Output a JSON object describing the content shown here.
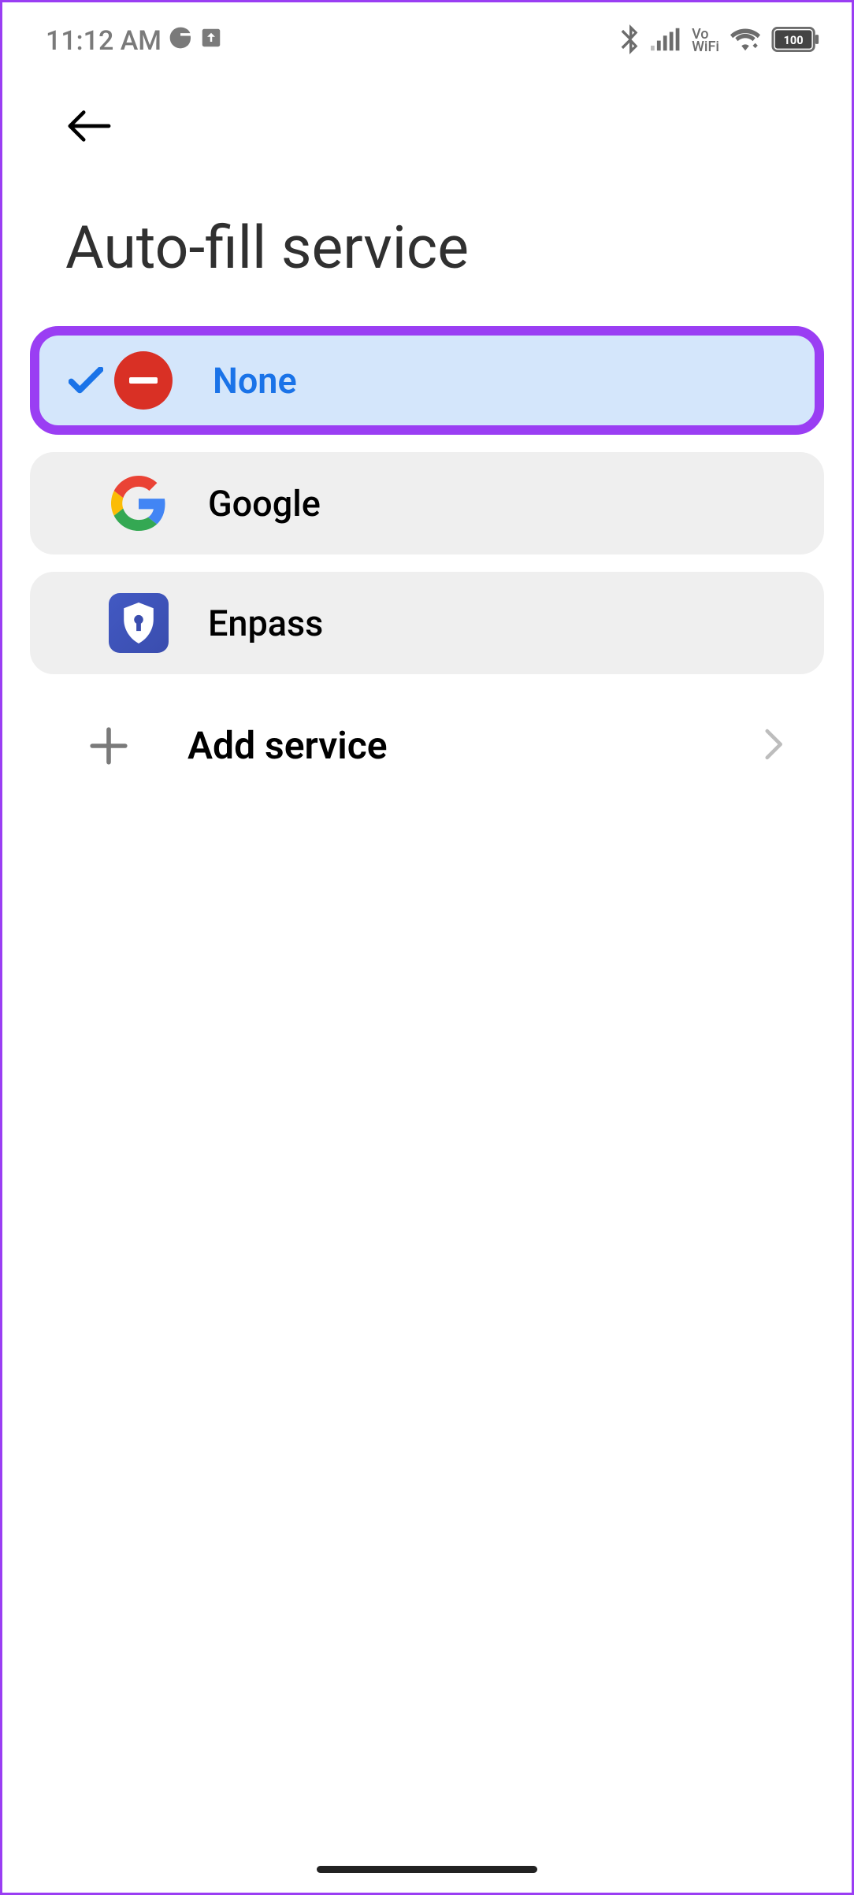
{
  "status_bar": {
    "time": "11:12 AM",
    "battery": "100",
    "vo": "Vo",
    "wifi": "WiFi"
  },
  "header": {
    "title": "Auto-fill service"
  },
  "options": [
    {
      "label": "None",
      "icon": "minus-circle-icon",
      "selected": true
    },
    {
      "label": "Google",
      "icon": "google-icon",
      "selected": false
    },
    {
      "label": "Enpass",
      "icon": "enpass-icon",
      "selected": false
    }
  ],
  "add_service": {
    "label": "Add service"
  }
}
